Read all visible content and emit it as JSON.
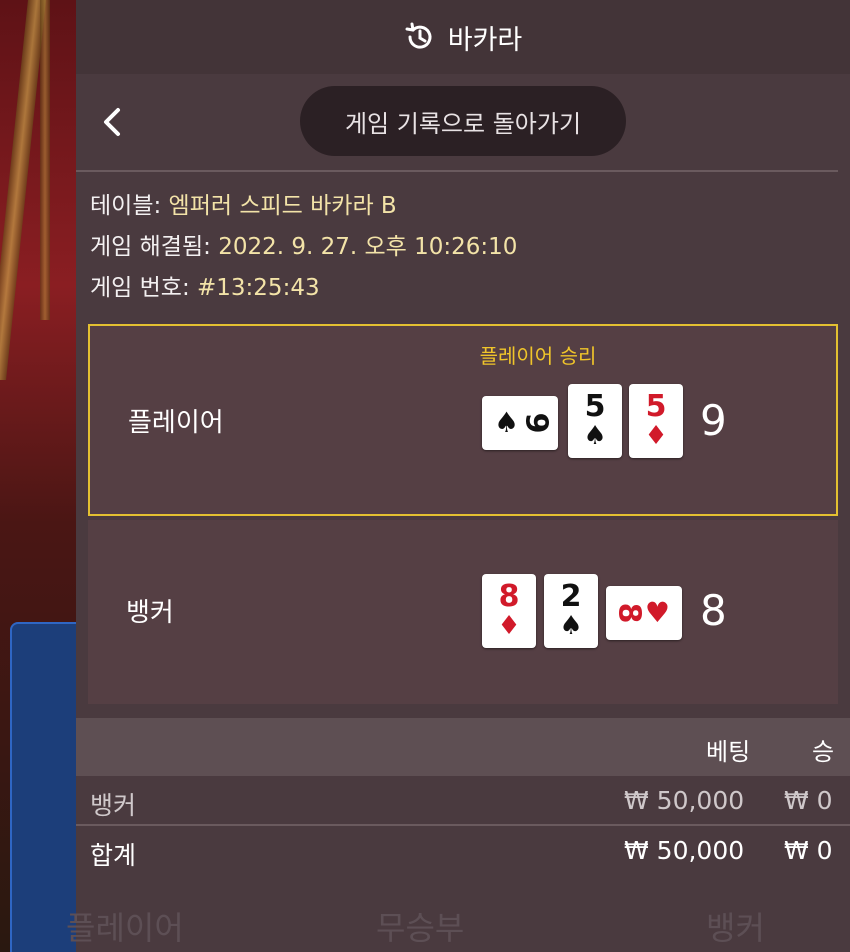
{
  "header": {
    "title": "바카라",
    "history_icon": "history-icon"
  },
  "nav": {
    "back_icon": "chevron-left-icon",
    "back_pill_label": "게임 기록으로 돌아가기"
  },
  "info": {
    "table_label": "테이블:",
    "table_value": "엠퍼러 스피드 바카라 B",
    "resolved_label": "게임 해결됨:",
    "resolved_value": "2022. 9. 27. 오후 10:26:10",
    "game_no_label": "게임 번호:",
    "game_no_value": "#13:25:43"
  },
  "result": {
    "winner_text": "플레이어 승리",
    "player": {
      "label": "플레이어",
      "score": "9",
      "cards": [
        {
          "rank": "9",
          "suit": "♠",
          "color": "#111111",
          "orientation": "horizontal"
        },
        {
          "rank": "5",
          "suit": "♠",
          "color": "#111111",
          "orientation": "vertical"
        },
        {
          "rank": "5",
          "suit": "♦",
          "color": "#d11a2a",
          "orientation": "vertical"
        }
      ]
    },
    "banker": {
      "label": "뱅커",
      "score": "8",
      "cards": [
        {
          "rank": "8",
          "suit": "♦",
          "color": "#d11a2a",
          "orientation": "vertical"
        },
        {
          "rank": "2",
          "suit": "♠",
          "color": "#111111",
          "orientation": "vertical"
        },
        {
          "rank": "8",
          "suit": "♥",
          "color": "#d11a2a",
          "orientation": "horizontal"
        }
      ]
    }
  },
  "bets_table": {
    "headers": {
      "bet": "베팅",
      "win": "승"
    },
    "rows": [
      {
        "name": "뱅커",
        "bet": "₩ 50,000",
        "win": "₩ 0"
      }
    ],
    "total": {
      "name": "합계",
      "bet": "₩ 50,000",
      "win": "₩ 0"
    }
  },
  "bottom_tabs": [
    "플레이어",
    "무승부",
    "뱅커"
  ],
  "colors": {
    "panel_bg": "#4a3a3f",
    "accent_gold": "#f0c52a",
    "value_text": "#f3e3a8"
  }
}
